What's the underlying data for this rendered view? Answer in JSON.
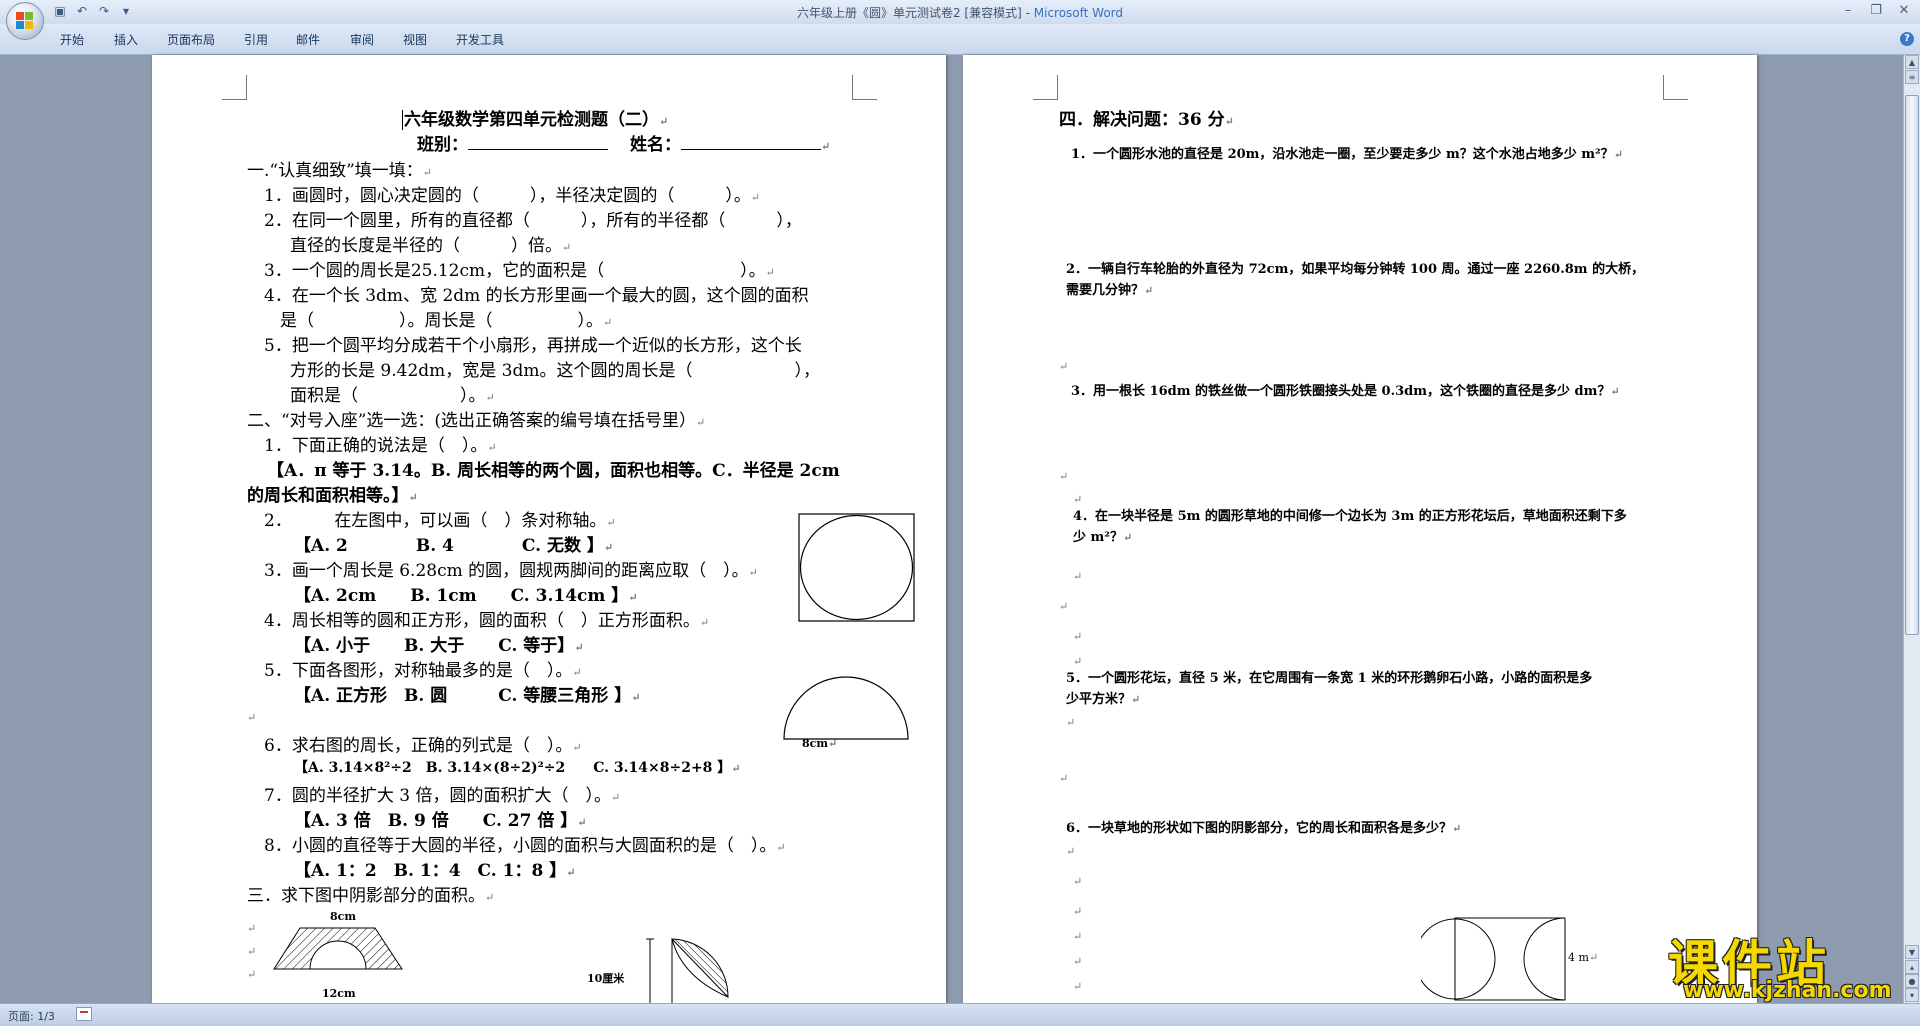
{
  "window": {
    "title": "六年级上册《圆》单元测试卷2 [兼容模式] - ",
    "app_name": "Microsoft Word"
  },
  "ribbon": {
    "tabs": [
      "开始",
      "插入",
      "页面布局",
      "引用",
      "邮件",
      "审阅",
      "视图",
      "开发工具"
    ],
    "help": "?"
  },
  "status": {
    "page": "页面: 1/3"
  },
  "watermark": {
    "brand": "课件站",
    "url": "www.kjzhan.com"
  },
  "page1": {
    "title": "六年级数学第四单元检测题（二）",
    "class_label": "班别：",
    "name_label": "姓名：",
    "s1": "一.“认真细致”填一填：",
    "s1_q1": "1．画圆时，圆心决定圆的（　　　），半径决定圆的（　　　）。",
    "s1_q2a": "2．在同一个圆里，所有的直径都（　　　），所有的半径都（　　　），",
    "s1_q2b": "直径的长度是半径的（　　　）倍。",
    "s1_q3": "3．一个圆的周长是25.12cm，它的面积是（　　　　　　　　）。",
    "s1_q4a": "4．在一个长 3dm、宽 2dm 的长方形里画一个最大的圆，这个圆的面积",
    "s1_q4b": "是（　　　　　）。周长是（　　　　　）。",
    "s1_q5a": "5．把一个圆平均分成若干个小扇形，再拼成一个近似的长方形，这个长",
    "s1_q5b": "方形的长是 9.42dm，宽是 3dm。这个圆的周长是（　　　　　　），",
    "s1_q5c": "面积是（　　　　　　）。",
    "s2": "二、“对号入座”选一选：(选出正确答案的编号填在括号里）",
    "s2_q1": "1．下面正确的说法是（　）。",
    "s2_q1_opts_a": "【A．π 等于 3.14。B. 周长相等的两个圆，面积也相等。C．半径是 2cm",
    "s2_q1_opts_b": "的周长和面积相等。】",
    "s2_q2": "2．　　　在左图中，可以画（　）条对称轴。",
    "s2_q2_opts": "【A. 2　　　　B. 4　　　　C. 无数 】",
    "s2_q3": "3．画一个周长是 6.28cm 的圆，圆规两脚间的距离应取（　）。",
    "s2_q3_opts": "【A. 2cm　　B. 1cm　　C. 3.14cm 】",
    "s2_q4": "4．周长相等的圆和正方形，圆的面积（　）正方形面积。",
    "s2_q4_opts": "【A. 小于　　B. 大于　　C. 等于】",
    "s2_q5": "5．下面各图形，对称轴最多的是（　）。",
    "s2_q5_opts": "【A. 正方形　B. 圆　　　C. 等腰三角形 】",
    "s2_q6": "6．求右图的周长，正确的列式是（　）。",
    "s2_q6_opts": "【A. 3.14×8²÷2　B. 3.14×(8÷2)²÷2　　C. 3.14×8÷2+8 】",
    "s2_q7": "7．圆的半径扩大 3 倍，圆的面积扩大（　）。",
    "s2_q7_opts": "【A. 3 倍　B. 9 倍　　C. 27 倍 】",
    "s2_q8": "8．小圆的直径等于大圆的半径，小圆的面积与大圆面积的是（　）。",
    "s2_q8_opts": "【A. 1：2　B. 1：4　C. 1：8 】",
    "s3": "三．求下图中阴影部分的面积。",
    "semi_label": "8cm",
    "trap_top": "8cm",
    "trap_bottom": "12cm",
    "sector_label": "10厘米"
  },
  "page2": {
    "s4": "四．解决问题：36 分",
    "q1": "1．一个圆形水池的直径是 20m，沿水池走一圈，至少要走多少 m？这个水池占地多少 m²？",
    "q2a": "2．一辆自行车轮胎的外直径为 72cm，如果平均每分钟转 100 周。通过一座 2260.8m 的大桥，",
    "q2b": "需要几分钟？",
    "q3": "3．用一根长 16dm 的铁丝做一个圆形铁圈接头处是 0.3dm，这个铁圈的直径是多少 dm？",
    "q4a": "4．在一块半径是 5m 的圆形草地的中间修一个边长为 3m 的正方形花坛后，草地面积还剩下多",
    "q4b": "少 m²？",
    "q5a": "5．一个圆形花坛，直径 5 米，在它周围有一条宽 1 米的环形鹅卵石小路，小路的面积是多",
    "q5b": "少平方米？",
    "q6": "6．一块草地的形状如下图的阴影部分，它的周长和面积各是多少？",
    "fig_label": "4 m"
  }
}
